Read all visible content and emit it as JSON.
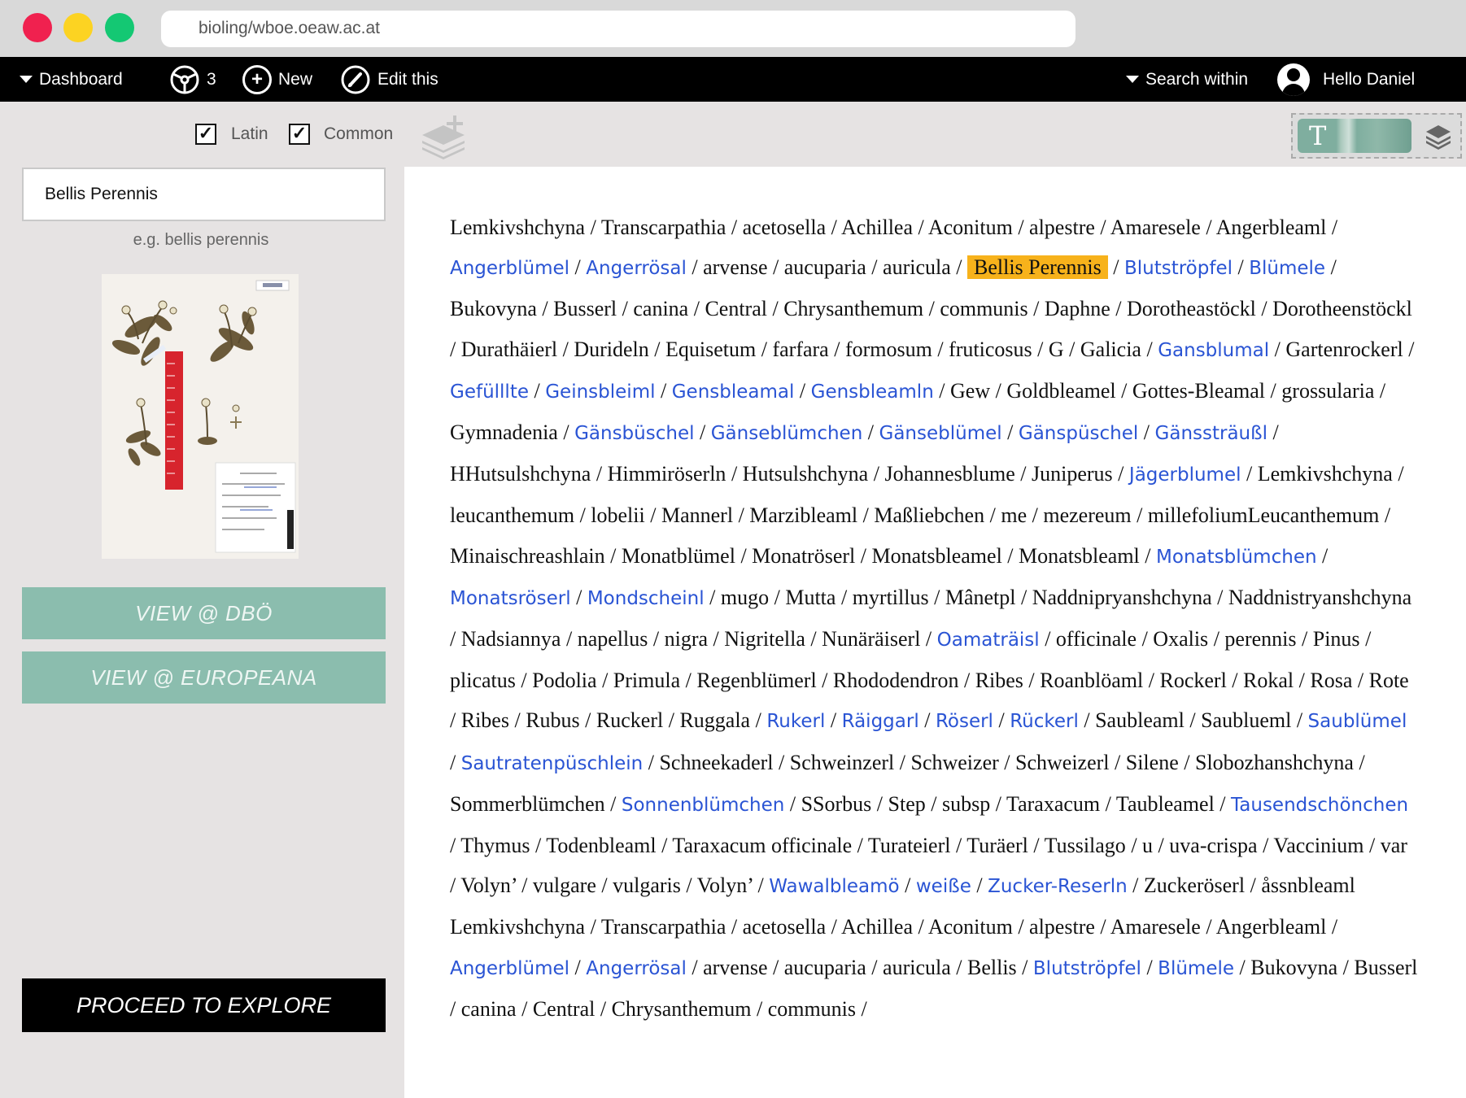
{
  "browser": {
    "url": "bioling/wboe.oeaw.ac.at"
  },
  "nav": {
    "dashboard": "Dashboard",
    "steering_count": "3",
    "new": "New",
    "edit": "Edit this",
    "search_within": "Search within",
    "user_greeting": "Hello Daniel"
  },
  "filters": {
    "latin_label": "Latin",
    "latin_checked": true,
    "common_label": "Common",
    "common_checked": true
  },
  "view_toggle": {
    "text_mode_glyph": "T"
  },
  "sidebar": {
    "search_value": "Bellis Perennis",
    "search_hint": "e.g. bellis perennis",
    "btn_dbo": "VIEW @ DBÖ",
    "btn_europeana": "VIEW @ EUROPEANA",
    "btn_proceed": "PROCEED TO EXPLORE"
  },
  "colors": {
    "link": "#2a54d4",
    "highlight": "#f7b21b",
    "teal_button": "#8bbdae",
    "nav_bg": "#000000"
  },
  "names": [
    {
      "t": "Lemkivshchyna"
    },
    {
      "t": "Transcarpathia"
    },
    {
      "t": "acetosella"
    },
    {
      "t": "Achillea"
    },
    {
      "t": "Aconitum"
    },
    {
      "t": "alpestre"
    },
    {
      "t": "Amaresele"
    },
    {
      "t": "Angerbleaml"
    },
    {
      "t": "Angerblümel",
      "s": "link"
    },
    {
      "t": "Angerrösal",
      "s": "link"
    },
    {
      "t": "arvense"
    },
    {
      "t": "aucuparia"
    },
    {
      "t": "auricula"
    },
    {
      "t": "Bellis Perennis",
      "s": "hl"
    },
    {
      "t": "Blutströpfel",
      "s": "link"
    },
    {
      "t": "Blümele",
      "s": "link"
    },
    {
      "t": "Bukovyna"
    },
    {
      "t": "Busserl"
    },
    {
      "t": "canina"
    },
    {
      "t": "Central"
    },
    {
      "t": "Chrysanthemum"
    },
    {
      "t": "communis"
    },
    {
      "t": "Daphne"
    },
    {
      "t": "Dorotheastöckl"
    },
    {
      "t": "Dorotheenstöckl"
    },
    {
      "t": "Durathäierl"
    },
    {
      "t": "Durideln"
    },
    {
      "t": "Equisetum"
    },
    {
      "t": "farfara"
    },
    {
      "t": "formosum"
    },
    {
      "t": "fruticosus"
    },
    {
      "t": "G"
    },
    {
      "t": "Galicia"
    },
    {
      "t": "Gansblumal",
      "s": "link"
    },
    {
      "t": "Gartenrockerl"
    },
    {
      "t": "Gefülllte",
      "s": "link"
    },
    {
      "t": "Geinsbleiml",
      "s": "link"
    },
    {
      "t": "Gensbleamal",
      "s": "link"
    },
    {
      "t": "Gensbleamln",
      "s": "link"
    },
    {
      "t": "Gew"
    },
    {
      "t": "Goldbleamel"
    },
    {
      "t": "Gottes-Bleamal"
    },
    {
      "t": "grossularia"
    },
    {
      "t": "Gymnadenia"
    },
    {
      "t": "Gänsbüschel",
      "s": "link"
    },
    {
      "t": "Gänseblümchen",
      "s": "link"
    },
    {
      "t": "Gänseblümel",
      "s": "link"
    },
    {
      "t": "Gänspüschel",
      "s": "link"
    },
    {
      "t": "Gänssträußl",
      "s": "link"
    },
    {
      "t": "HHutsulshchyna"
    },
    {
      "t": "Himmiröserln"
    },
    {
      "t": "Hutsulshchyna"
    },
    {
      "t": "Johannesblume"
    },
    {
      "t": "Juniperus"
    },
    {
      "t": "Jägerblumel",
      "s": "link"
    },
    {
      "t": "Lemkivshchyna"
    },
    {
      "t": "leucanthemum"
    },
    {
      "t": "lobelii"
    },
    {
      "t": "Mannerl"
    },
    {
      "t": "Marzibleaml"
    },
    {
      "t": "Maßliebchen"
    },
    {
      "t": "me"
    },
    {
      "t": "mezereum"
    },
    {
      "t": "millefoliumLeucanthemum"
    },
    {
      "t": "Minaischreashlain"
    },
    {
      "t": "Monatblümel"
    },
    {
      "t": "Monatröserl"
    },
    {
      "t": "Monatsbleamel"
    },
    {
      "t": "Monatsbleaml"
    },
    {
      "t": "Monatsblümchen",
      "s": "link"
    },
    {
      "t": "Monatsröserl",
      "s": "link"
    },
    {
      "t": "Mondscheinl",
      "s": "link"
    },
    {
      "t": "mugo"
    },
    {
      "t": "Mutta"
    },
    {
      "t": "myrtillus"
    },
    {
      "t": "Mânetpl"
    },
    {
      "t": "Naddnipryanshchyna"
    },
    {
      "t": "Naddnistryanshchyna"
    },
    {
      "t": "Nadsiannya"
    },
    {
      "t": "napellus"
    },
    {
      "t": "nigra"
    },
    {
      "t": "Nigritella"
    },
    {
      "t": "Nunäräiserl"
    },
    {
      "t": "Oamaträisl",
      "s": "link"
    },
    {
      "t": "officinale"
    },
    {
      "t": "Oxalis"
    },
    {
      "t": "perennis"
    },
    {
      "t": "Pinus"
    },
    {
      "t": "plicatus"
    },
    {
      "t": "Podolia"
    },
    {
      "t": "Primula"
    },
    {
      "t": "Regenblümerl"
    },
    {
      "t": "Rhododendron"
    },
    {
      "t": "Ribes"
    },
    {
      "t": "Roanblöaml"
    },
    {
      "t": "Rockerl"
    },
    {
      "t": "Rokal"
    },
    {
      "t": "Rosa"
    },
    {
      "t": "Rote"
    },
    {
      "t": "Ribes"
    },
    {
      "t": "Rubus"
    },
    {
      "t": "Ruckerl"
    },
    {
      "t": "Ruggala"
    },
    {
      "t": "Rukerl",
      "s": "link"
    },
    {
      "t": "Räiggarl",
      "s": "link"
    },
    {
      "t": "Röserl",
      "s": "link"
    },
    {
      "t": "Rückerl",
      "s": "link"
    },
    {
      "t": "Saubleaml"
    },
    {
      "t": "Saublueml"
    },
    {
      "t": "Saublümel",
      "s": "link"
    },
    {
      "t": "Sautratenpüschlein",
      "s": "link"
    },
    {
      "t": "Schneekaderl"
    },
    {
      "t": "Schweinzerl"
    },
    {
      "t": "Schweizer"
    },
    {
      "t": "Schweizerl"
    },
    {
      "t": "Silene"
    },
    {
      "t": "Slobozhanshchyna"
    },
    {
      "t": "Sommerblümchen"
    },
    {
      "t": "Sonnenblümchen",
      "s": "link"
    },
    {
      "t": "SSorbus"
    },
    {
      "t": "Step"
    },
    {
      "t": "subsp"
    },
    {
      "t": "Taraxacum"
    },
    {
      "t": "Taubleamel"
    },
    {
      "t": "Tausendschönchen",
      "s": "link"
    },
    {
      "t": "Thymus"
    },
    {
      "t": "Todenbleaml"
    },
    {
      "t": "Taraxacum officinale"
    },
    {
      "t": "Turateierl"
    },
    {
      "t": "Turäerl"
    },
    {
      "t": "Tussilago"
    },
    {
      "t": "u"
    },
    {
      "t": "uva-crispa"
    },
    {
      "t": "Vaccinium"
    },
    {
      "t": "var"
    },
    {
      "t": "Volyn’"
    },
    {
      "t": "vulgare"
    },
    {
      "t": "vulgaris"
    },
    {
      "t": "Volyn’"
    },
    {
      "t": "Wawalbleamö",
      "s": "link"
    },
    {
      "t": "weiße",
      "s": "link"
    },
    {
      "t": "Zucker-Reserln",
      "s": "link"
    },
    {
      "t": "Zuckeröserl"
    },
    {
      "t": "åssnbleaml Lemkivshchyna"
    },
    {
      "t": "Transcarpathia"
    },
    {
      "t": "acetosella"
    },
    {
      "t": "Achillea"
    },
    {
      "t": "Aconitum"
    },
    {
      "t": "alpestre"
    },
    {
      "t": "Amaresele"
    },
    {
      "t": "Angerbleaml"
    },
    {
      "t": "Angerblümel",
      "s": "link"
    },
    {
      "t": "Angerrösal",
      "s": "link"
    },
    {
      "t": "arvense"
    },
    {
      "t": "aucuparia"
    },
    {
      "t": "auricula"
    },
    {
      "t": "Bellis"
    },
    {
      "t": "Blutströpfel",
      "s": "link"
    },
    {
      "t": "Blümele",
      "s": "link"
    },
    {
      "t": "Bukovyna"
    },
    {
      "t": "Busserl"
    },
    {
      "t": "canina"
    },
    {
      "t": "Central"
    },
    {
      "t": "Chrysanthemum"
    },
    {
      "t": "communis"
    }
  ]
}
